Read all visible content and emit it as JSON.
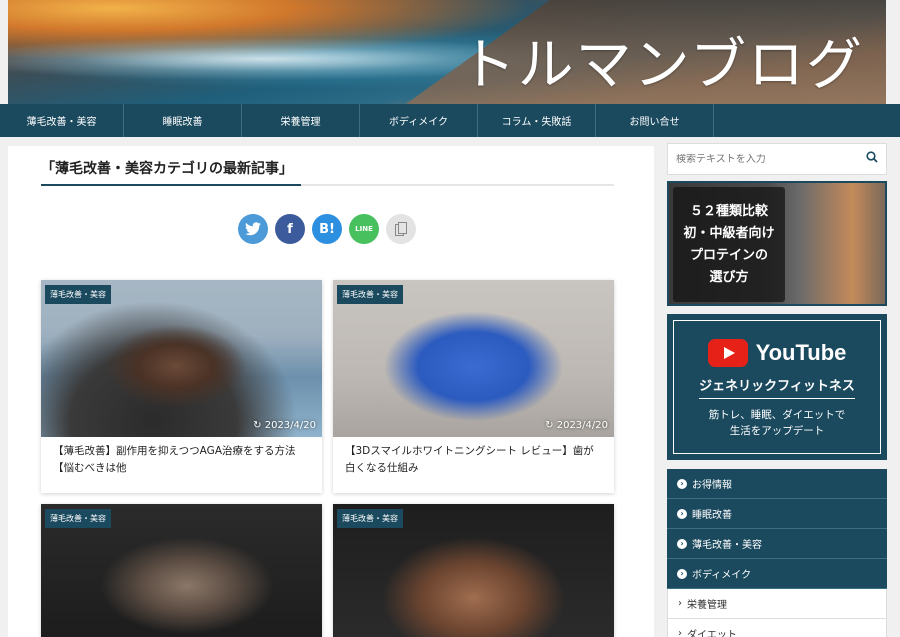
{
  "header": {
    "site_title": "トルマンブログ"
  },
  "nav": {
    "items": [
      "薄毛改善・美容",
      "睡眠改善",
      "栄養管理",
      "ボディメイク",
      "コラム・失敗話",
      "お問い合せ"
    ]
  },
  "main": {
    "category_heading": "「薄毛改善・美容カテゴリの最新記事」",
    "share": {
      "twitter": "twitter-icon",
      "facebook": "f",
      "hatena": "B!",
      "line": "LINE",
      "copy": "copy-icon"
    },
    "cards": [
      {
        "category": "薄毛改善・美容",
        "date": "2023/4/20",
        "title": "【薄毛改善】副作用を抑えつつAGA治療をする方法【悩むべきは他"
      },
      {
        "category": "薄毛改善・美容",
        "date": "2023/4/20",
        "title": "【3Dスマイルホワイトニングシート レビュー】歯が白くなる仕組み"
      },
      {
        "category": "薄毛改善・美容",
        "date": "",
        "title": ""
      },
      {
        "category": "薄毛改善・美容",
        "date": "",
        "title": ""
      }
    ]
  },
  "sidebar": {
    "search_placeholder": "検索テキストを入力",
    "banner1": {
      "line1": "５２種類比較",
      "line2": "初・中級者向け",
      "line3": "プロテインの",
      "line4": "選び方"
    },
    "banner2": {
      "logo": "YouTube",
      "channel": "ジェネリックフィットネス",
      "desc1": "筋トレ、睡眠、ダイエットで",
      "desc2": "生活をアップデート"
    },
    "categories": [
      {
        "label": "お得情報"
      },
      {
        "label": "睡眠改善"
      },
      {
        "label": "薄毛改善・美容"
      },
      {
        "label": "ボディメイク"
      }
    ],
    "subcategories": [
      {
        "label": "栄養管理"
      },
      {
        "label": "ダイエット"
      }
    ]
  },
  "colors": {
    "primary": "#1b4a5f",
    "twitter": "#4c9bd8",
    "facebook": "#3b5b9c",
    "hatena": "#2d8fe0",
    "line": "#47c05d",
    "youtube": "#e62117"
  }
}
